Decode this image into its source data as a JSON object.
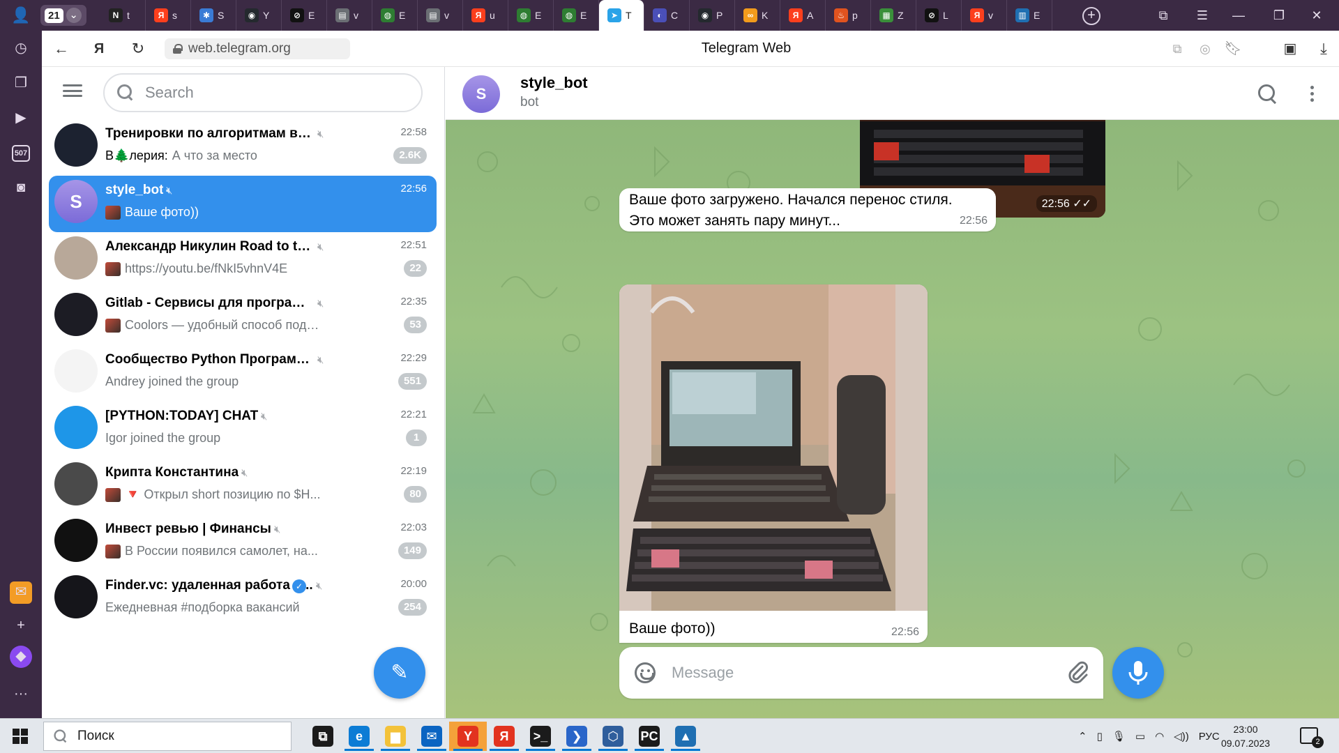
{
  "browser": {
    "tab_counter": "21",
    "tabs": [
      {
        "icon": "notion-icon",
        "label": "t",
        "color": "#222222",
        "glyph": "N"
      },
      {
        "icon": "yandex-icon",
        "label": "s",
        "color": "#fc3f1d",
        "glyph": "Я"
      },
      {
        "icon": "site-icon",
        "label": "S",
        "color": "#3a7bd5",
        "glyph": "✱"
      },
      {
        "icon": "github-icon",
        "label": "Y",
        "color": "#24292e",
        "glyph": "◉"
      },
      {
        "icon": "chain-icon",
        "label": "E",
        "color": "#111111",
        "glyph": "⊘"
      },
      {
        "icon": "document-icon",
        "label": "v",
        "color": "#6b6f74",
        "glyph": "▤"
      },
      {
        "icon": "circle-icon",
        "label": "E",
        "color": "#2e7d32",
        "glyph": "◍"
      },
      {
        "icon": "document-icon",
        "label": "v",
        "color": "#6b6f74",
        "glyph": "▤"
      },
      {
        "icon": "yandex-icon",
        "label": "u",
        "color": "#fc3f1d",
        "glyph": "Я"
      },
      {
        "icon": "circle-icon",
        "label": "E",
        "color": "#2e7d32",
        "glyph": "◍"
      },
      {
        "icon": "circle-icon",
        "label": "E",
        "color": "#2e7d32",
        "glyph": "◍"
      },
      {
        "icon": "telegram-icon",
        "label": "T",
        "color": "#2aa3e8",
        "glyph": "➤",
        "active": true
      },
      {
        "icon": "site-icon",
        "label": "C",
        "color": "#4a4fb8",
        "glyph": "◐"
      },
      {
        "icon": "github-icon",
        "label": "P",
        "color": "#24292e",
        "glyph": "◉"
      },
      {
        "icon": "infinity-icon",
        "label": "K",
        "color": "#f29b1c",
        "glyph": "∞"
      },
      {
        "icon": "yandex-icon",
        "label": "A",
        "color": "#fc3f1d",
        "glyph": "Я"
      },
      {
        "icon": "fire-icon",
        "label": "p",
        "color": "#e0531f",
        "glyph": "♨"
      },
      {
        "icon": "microsoft-icon",
        "label": "Z",
        "color": "#3a8f3a",
        "glyph": "▦"
      },
      {
        "icon": "chain-icon",
        "label": "L",
        "color": "#111111",
        "glyph": "⊘"
      },
      {
        "icon": "yandex-icon",
        "label": "v",
        "color": "#fc3f1d",
        "glyph": "Я"
      },
      {
        "icon": "chart-icon",
        "label": "E",
        "color": "#1f6fb2",
        "glyph": "▥"
      }
    ]
  },
  "sidepanel": {
    "counter": "507"
  },
  "addressbar": {
    "url": "web.telegram.org",
    "title": "Telegram Web"
  },
  "telegram": {
    "search_placeholder": "Search",
    "chats": [
      {
        "name": "Тренировки по алгоритмам в Ян...",
        "time": "22:58",
        "sender": "В🌲лерия:",
        "last": "А что за место",
        "badge": "2.6K",
        "avatar_color": "#1c2230",
        "avatar_text": "",
        "muted": true
      },
      {
        "name": "style_bot",
        "time": "22:56",
        "sender": "",
        "last": "Ваше фото))",
        "badge": "",
        "avatar_color": "#8a79e0",
        "avatar_text": "S",
        "muted": true,
        "active": true,
        "thumb": true
      },
      {
        "name": "Александр Никулин Road to the B...",
        "time": "22:51",
        "sender": "",
        "last": "https://youtu.be/fNkI5vhnV4E",
        "badge": "22",
        "avatar_color": "#b8a899",
        "avatar_text": "",
        "muted": true,
        "thumb": true
      },
      {
        "name": "Gitlab - Сервисы для программи...",
        "time": "22:35",
        "sender": "",
        "last": "Coolors — удобный способ подо...",
        "badge": "53",
        "avatar_color": "#1c1c24",
        "avatar_text": "",
        "muted": true,
        "thumb": true
      },
      {
        "name": "Сообщество Python Программис...",
        "time": "22:29",
        "sender": "",
        "last": "Andrey joined the group",
        "badge": "551",
        "avatar_color": "#f4f4f4",
        "avatar_text": "",
        "muted": true
      },
      {
        "name": "[PYTHON:TODAY] CHAT",
        "time": "22:21",
        "sender": "",
        "last": "Igor joined the group",
        "badge": "1",
        "avatar_color": "#1e96e8",
        "avatar_text": "",
        "muted": true
      },
      {
        "name": "Крипта Константина",
        "time": "22:19",
        "sender": "",
        "last": "🔻 Открыл short позицию по $H...",
        "badge": "80",
        "avatar_color": "#4a4a4a",
        "avatar_text": "",
        "muted": true,
        "thumb": true
      },
      {
        "name": "Инвест ревью | Финансы",
        "time": "22:03",
        "sender": "",
        "last": "В России появился самолет, на...",
        "badge": "149",
        "avatar_color": "#111111",
        "avatar_text": "",
        "muted": true,
        "thumb": true
      },
      {
        "name": "Finder.vc: удаленная работа - ...",
        "time": "20:00",
        "sender": "",
        "last": "Ежедневная #подборка вакансий",
        "badge": "254",
        "avatar_color": "#15151a",
        "avatar_text": "",
        "muted": true,
        "verified": true
      }
    ]
  },
  "chat": {
    "title": "style_bot",
    "subtitle": "bot",
    "avatar_text": "S",
    "photo_time": "22:56 ✓✓",
    "status_message": "Ваше фото загружено. Начался перенос стиля. Это может занять пару минут...",
    "status_time": "22:56",
    "caption": "Ваше фото))",
    "caption_time": "22:56",
    "composer_placeholder": "Message"
  },
  "taskbar": {
    "search_placeholder": "Поиск",
    "language": "РУС",
    "time": "23:00",
    "date": "09.07.2023",
    "notification_count": "2",
    "apps": [
      {
        "icon": "task-view-icon",
        "glyph": "⧉",
        "color": "#1b1b1b"
      },
      {
        "icon": "edge-icon",
        "glyph": "e",
        "color": "#0c7cd5"
      },
      {
        "icon": "explorer-icon",
        "glyph": "▆",
        "color": "#f3c23a"
      },
      {
        "icon": "mail-icon",
        "glyph": "✉",
        "color": "#0a64c2"
      },
      {
        "icon": "yandex-browser-icon",
        "glyph": "Y",
        "color": "#e2331f"
      },
      {
        "icon": "yandex-icon",
        "glyph": "Я",
        "color": "#e2331f"
      },
      {
        "icon": "terminal-icon",
        "glyph": ">_",
        "color": "#1b1b1b"
      },
      {
        "icon": "powershell-icon",
        "glyph": "❯",
        "color": "#2a66c9"
      },
      {
        "icon": "virtualbox-icon",
        "glyph": "⬡",
        "color": "#2f5e9c"
      },
      {
        "icon": "pycharm-icon",
        "glyph": "PC",
        "color": "#1b1b1b"
      },
      {
        "icon": "photos-icon",
        "glyph": "▲",
        "color": "#1f6fb2"
      }
    ]
  }
}
